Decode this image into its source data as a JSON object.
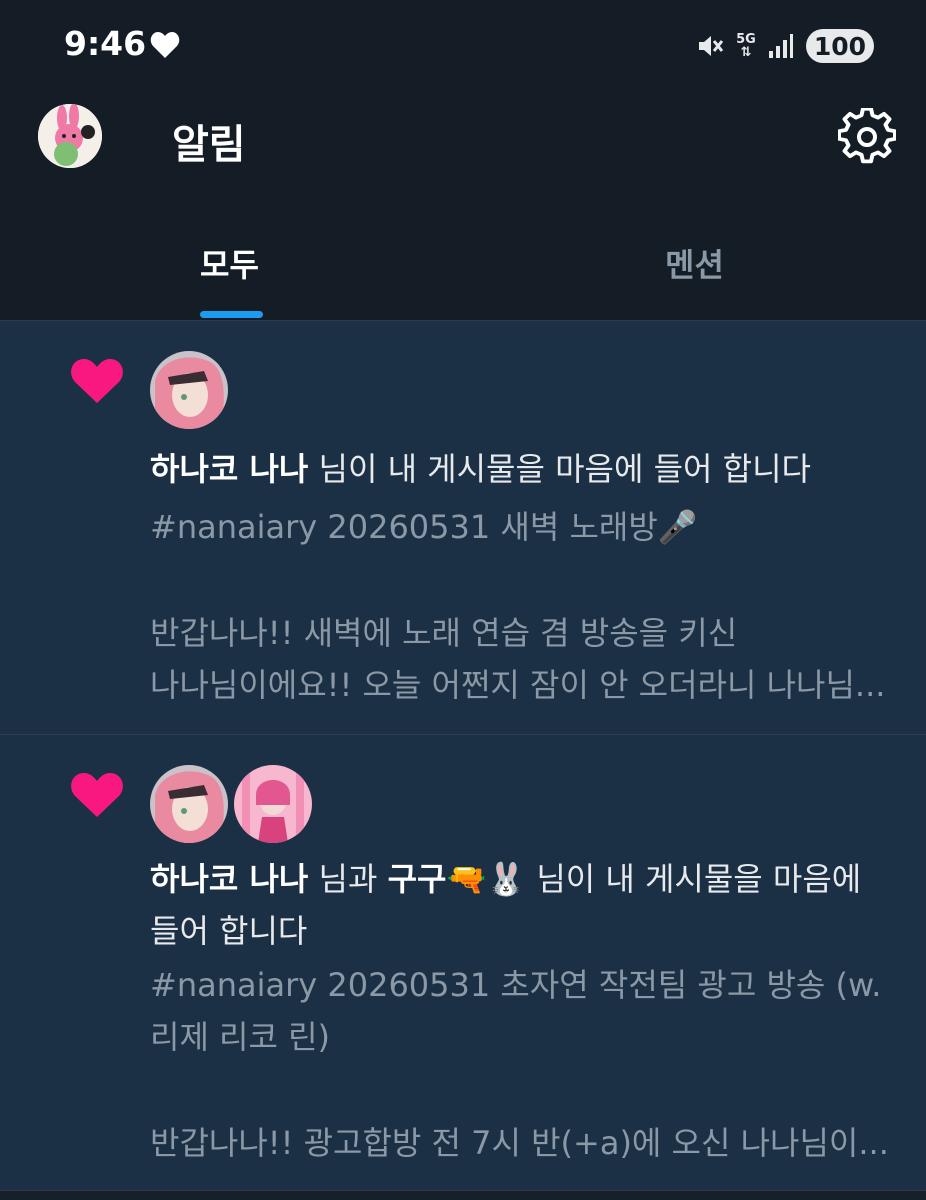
{
  "status": {
    "time": "9:46",
    "network": "5G",
    "battery": "100"
  },
  "header": {
    "title": "알림"
  },
  "tabs": [
    {
      "label": "모두",
      "selected": true
    },
    {
      "label": "멘션",
      "selected": false
    }
  ],
  "notifications": [
    {
      "type": "like",
      "user": "하나코 나나",
      "action": " 님이 내 게시물을 마음에 들어 합니다",
      "preview": [
        "#nanaiary 20260531 새벽 노래방🎤",
        "",
        "반갑나나!! 새벽에 노래 연습 겸 방송을 키신",
        "나나님이에요!! 오늘 어쩐지 잠이 안 오더라니 나나님..."
      ]
    },
    {
      "type": "like",
      "user1": "하나코 나나",
      "joiner": " 님과 ",
      "user2": "구구🔫🐰",
      "action_line1": " 님이 내 게시물을 마음에",
      "action_line2": "들어 합니다",
      "preview": [
        "#nanaiary 20260531 초자연 작전팀 광고 방송 (w.",
        "리제 리코 린)",
        "",
        "반갑나나!! 광고합방 전 7시 반(+a)에 오신 나나님이..."
      ]
    }
  ],
  "colors": {
    "accent": "#1d9bf0",
    "heart": "#f91880",
    "background": "#15202b",
    "notification_bg": "#1b2f45",
    "muted_text": "#8b98a5"
  },
  "icons": [
    "heart-icon",
    "mute-icon",
    "signal-icon",
    "gear-icon",
    "like-heart-icon"
  ]
}
